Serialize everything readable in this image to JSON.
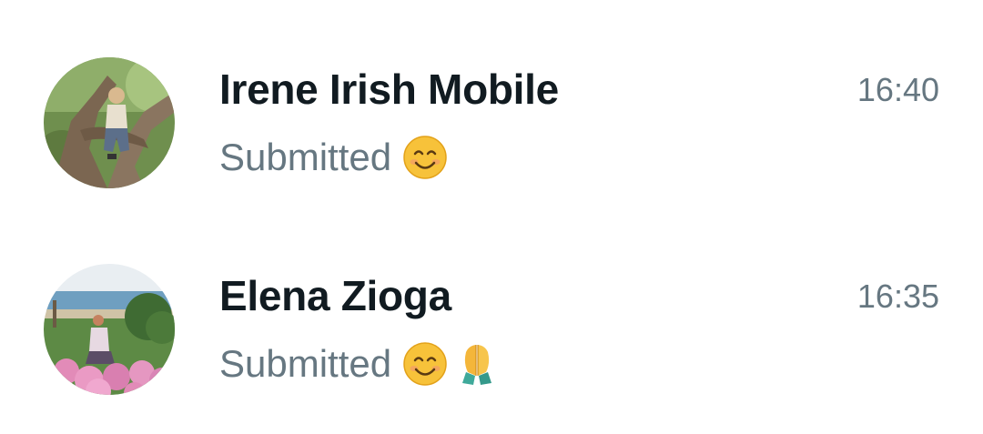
{
  "chats": [
    {
      "name": "Irene Irish Mobile",
      "time": "16:40",
      "preview": "Submitted",
      "emojis": [
        "smiling-face-emoji"
      ]
    },
    {
      "name": "Elena Zioga",
      "time": "16:35",
      "preview": "Submitted",
      "emojis": [
        "smiling-face-emoji",
        "folded-hands-emoji"
      ]
    }
  ],
  "colors": {
    "name": "#111b21",
    "secondary": "#667781",
    "emoji_face": "#f7c23a"
  }
}
